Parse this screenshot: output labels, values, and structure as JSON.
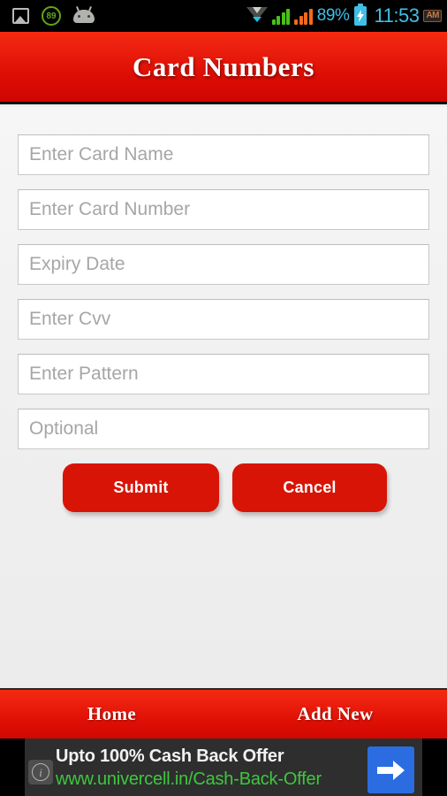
{
  "status_bar": {
    "gallery_icon": "gallery-icon",
    "progress_icon": "progress-circle-icon",
    "progress_value": "89",
    "android_icon": "android-head-icon",
    "wifi_icon": "wifi-icon",
    "signal_1_icon": "signal-bars-green-icon",
    "signal_2_icon": "signal-bars-orange-icon",
    "battery_percent": "89%",
    "battery_icon": "battery-charging-icon",
    "clock": "11:53",
    "meridiem": "AM"
  },
  "header": {
    "title": "Card Numbers"
  },
  "form": {
    "fields": [
      {
        "name": "card-name",
        "placeholder": "Enter Card Name",
        "value": ""
      },
      {
        "name": "card-number",
        "placeholder": "Enter Card Number",
        "value": ""
      },
      {
        "name": "expiry-date",
        "placeholder": "Expiry Date",
        "value": ""
      },
      {
        "name": "cvv",
        "placeholder": "Enter Cvv",
        "value": ""
      },
      {
        "name": "pattern",
        "placeholder": "Enter Pattern",
        "value": ""
      },
      {
        "name": "optional",
        "placeholder": "Optional",
        "value": ""
      }
    ],
    "submit_label": "Submit",
    "cancel_label": "Cancel"
  },
  "bottom_nav": {
    "items": [
      {
        "label": "Home"
      },
      {
        "label": "Add New"
      }
    ]
  },
  "ad": {
    "info_icon": "info-icon",
    "headline": "Upto 100% Cash Back Offer",
    "url": "www.univercell.in/Cash-Back-Offer",
    "cta_icon": "arrow-right-icon"
  },
  "colors": {
    "brand_red": "#d81406",
    "header_red_top": "#f42a11",
    "header_red_bottom": "#cf0601",
    "content_bg": "#efefef",
    "field_border": "#c8c8c8",
    "placeholder_text": "#a6a6a6",
    "status_bar_bg": "#000000",
    "status_accent": "#3fbfe6",
    "signal_green": "#49c118",
    "signal_orange": "#f4691a",
    "ad_bg": "#2e2e2e",
    "ad_url_green": "#3ec73e",
    "ad_cta_blue": "#2b6de0"
  }
}
